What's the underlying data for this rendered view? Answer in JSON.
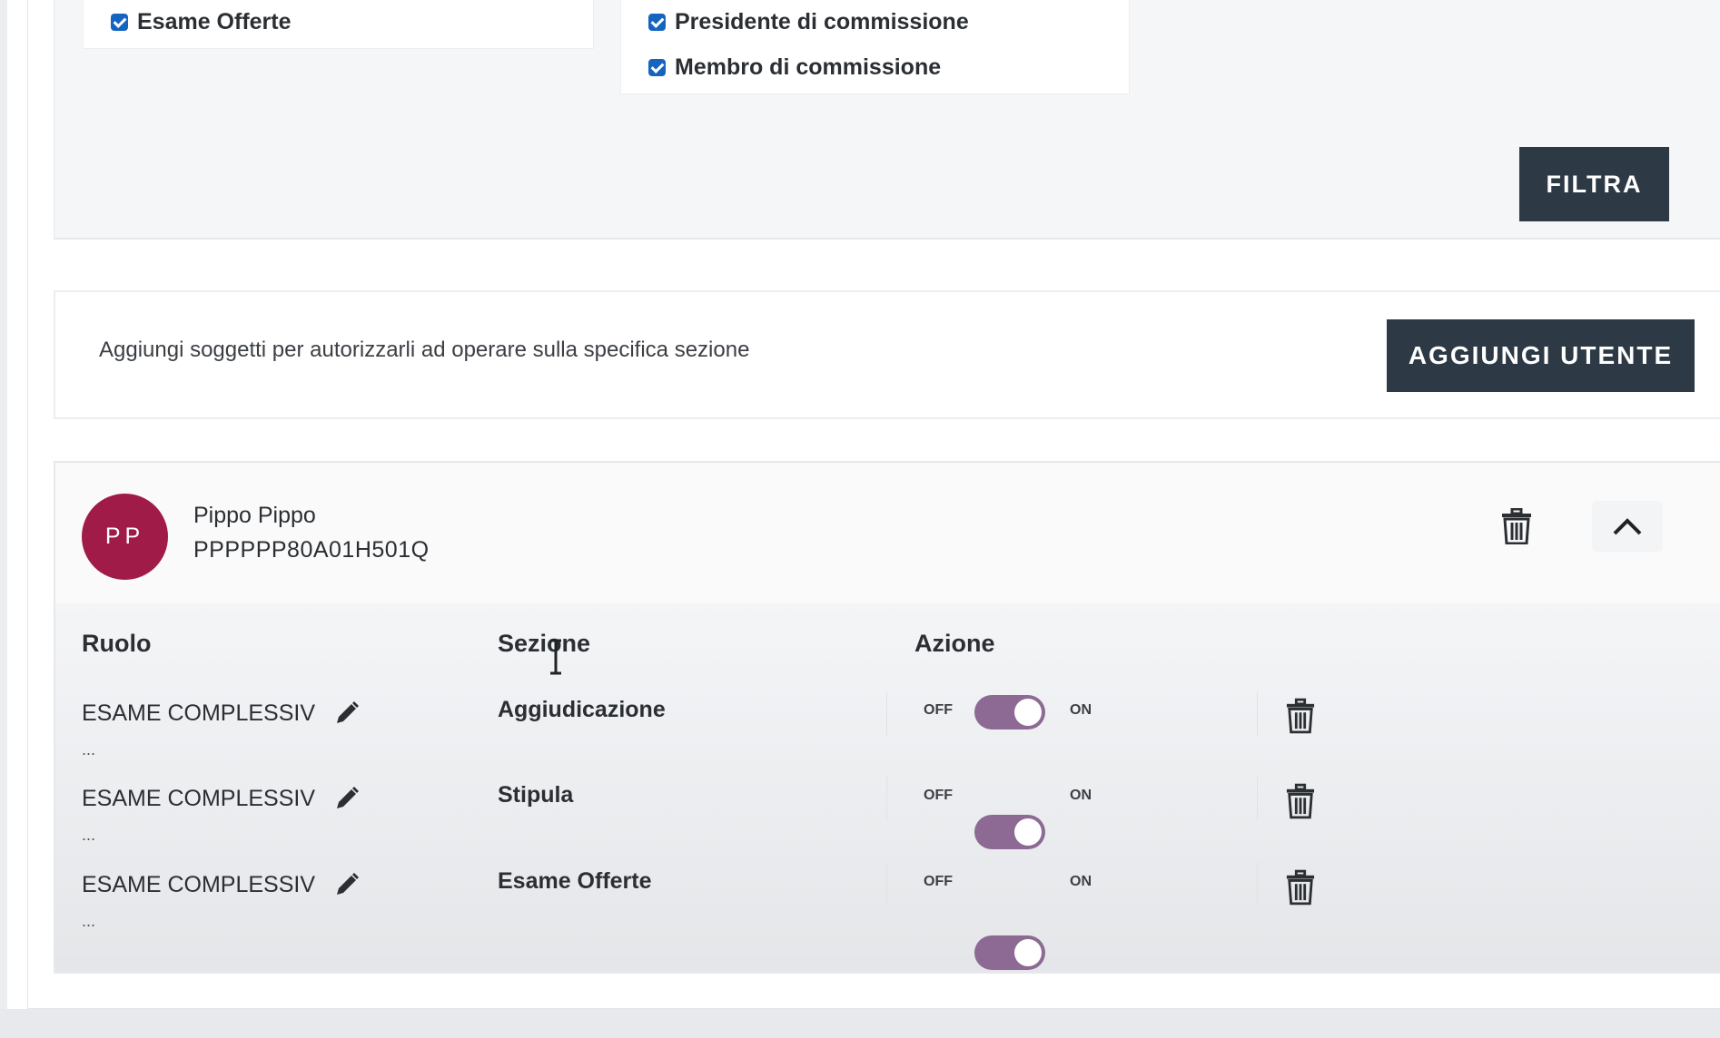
{
  "filters": {
    "column_a": [
      {
        "label": "Esame Offerte",
        "checked": true
      }
    ],
    "column_b": [
      {
        "label": "Presidente di commissione",
        "checked": true
      },
      {
        "label": "Membro di commissione",
        "checked": true
      }
    ],
    "filter_button_label": "FILTRA"
  },
  "add_user": {
    "description": "Aggiungi soggetti per autorizzarli ad operare sulla specifica sezione",
    "button_label": "AGGIUNGI UTENTE"
  },
  "user": {
    "initials": "PP",
    "name": "Pippo Pippo",
    "fiscal_code": "PPPPPP80A01H501Q",
    "avatar_color": "#a01b47"
  },
  "roles_table": {
    "headers": {
      "ruolo": "Ruolo",
      "sezione": "Sezione",
      "azione": "Azione"
    },
    "rows": [
      {
        "role": "ESAME COMPLESSIV",
        "role_more": "...",
        "section": "Aggiudicazione",
        "toggle_off_label": "OFF",
        "toggle_on_label": "ON",
        "enabled": true
      },
      {
        "role": "ESAME COMPLESSIV",
        "role_more": "...",
        "section": "Stipula",
        "toggle_off_label": "OFF",
        "toggle_on_label": "ON",
        "enabled": true
      },
      {
        "role": "ESAME COMPLESSIV",
        "role_more": "...",
        "section": "Esame Offerte",
        "toggle_off_label": "OFF",
        "toggle_on_label": "ON",
        "enabled": true
      }
    ]
  },
  "colors": {
    "button_dark": "#2d3a45",
    "checkbox": "#1565c0",
    "toggle_on": "#8c6a93"
  }
}
